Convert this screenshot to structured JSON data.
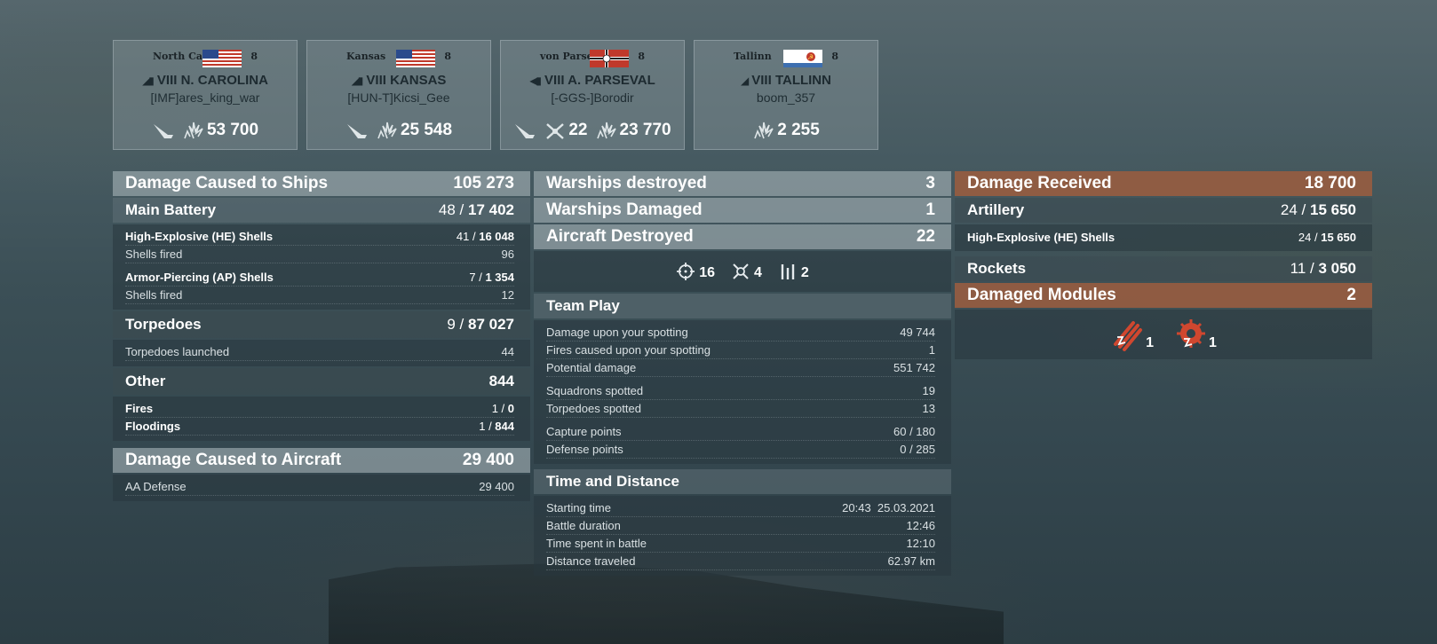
{
  "ships": [
    {
      "name": "North Carolina",
      "tier": "8",
      "flag": "usa",
      "tier_roman": "VIII",
      "title": "N. CAROLINA",
      "player": "[IMF]ares_king_war",
      "plane_icon": true,
      "cap_value": null,
      "damage": "53 700"
    },
    {
      "name": "Kansas",
      "tier": "8",
      "flag": "usa",
      "tier_roman": "VIII",
      "title": "KANSAS",
      "player": "[HUN-T]Kicsi_Gee",
      "plane_icon": true,
      "cap_value": null,
      "damage": "25 548"
    },
    {
      "name": "von Parseval",
      "tier": "8",
      "flag": "germany",
      "tier_roman": "VIII",
      "title": "A. PARSEVAL",
      "player": "[-GGS-]Borodir",
      "plane_icon": true,
      "cap_value": "22",
      "damage": "23 770"
    },
    {
      "name": "Tallinn",
      "tier": "8",
      "flag": "ussr",
      "tier_roman": "VIII",
      "title": "TALLINN",
      "player": "boom_357",
      "plane_icon": false,
      "cap_value": null,
      "damage": "2 255"
    }
  ],
  "damage_ships": {
    "label": "Damage Caused to Ships",
    "value": "105 273",
    "main_battery": {
      "label": "Main Battery",
      "hits": "48",
      "dmg": "17 402"
    },
    "he": {
      "label": "High-Explosive (HE) Shells",
      "hits": "41",
      "dmg": "16 048",
      "fired_label": "Shells fired",
      "fired": "96"
    },
    "ap": {
      "label": "Armor-Piercing (AP) Shells",
      "hits": "7",
      "dmg": "1 354",
      "fired_label": "Shells fired",
      "fired": "12"
    },
    "torpedoes": {
      "label": "Torpedoes",
      "hits": "9",
      "dmg": "87 027",
      "launched_label": "Torpedoes launched",
      "launched": "44"
    },
    "other": {
      "label": "Other",
      "value": "844",
      "fires": {
        "label": "Fires",
        "hits": "1",
        "dmg": "0"
      },
      "floodings": {
        "label": "Floodings",
        "hits": "1",
        "dmg": "844"
      }
    }
  },
  "damage_aircraft": {
    "label": "Damage Caused to Aircraft",
    "value": "29 400",
    "aa_label": "AA Defense",
    "aa": "29 400"
  },
  "warships_destroyed": {
    "label": "Warships destroyed",
    "value": "3"
  },
  "warships_damaged": {
    "label": "Warships Damaged",
    "value": "1"
  },
  "aircraft_destroyed": {
    "label": "Aircraft Destroyed",
    "value": "22",
    "icons": [
      {
        "icon": "crosshair-icon",
        "value": "16"
      },
      {
        "icon": "crossed-fighter-icon",
        "value": "4"
      },
      {
        "icon": "rockets-icon",
        "value": "2"
      }
    ]
  },
  "team_play": {
    "label": "Team Play",
    "rows": [
      {
        "label": "Damage upon your spotting",
        "value": "49 744"
      },
      {
        "label": "Fires caused upon your spotting",
        "value": "1"
      },
      {
        "label": "Potential damage",
        "value": "551 742"
      },
      {
        "label": "Squadrons spotted",
        "value": "19"
      },
      {
        "label": "Torpedoes spotted",
        "value": "13"
      },
      {
        "label": "Capture points",
        "value": "60 / 180"
      },
      {
        "label": "Defense points",
        "value": "0 / 285"
      }
    ]
  },
  "time_distance": {
    "label": "Time and Distance",
    "rows": [
      {
        "label": "Starting time",
        "value": "20:43  25.03.2021"
      },
      {
        "label": "Battle duration",
        "value": "12:46"
      },
      {
        "label": "Time spent in battle",
        "value": "12:10"
      },
      {
        "label": "Distance traveled",
        "value": "62.97 km"
      }
    ]
  },
  "damage_received": {
    "label": "Damage Received",
    "value": "18 700",
    "artillery": {
      "label": "Artillery",
      "hits": "24",
      "dmg": "15 650"
    },
    "he": {
      "label": "High-Explosive (HE) Shells",
      "hits": "24",
      "dmg": "15 650"
    },
    "rockets": {
      "label": "Rockets",
      "hits": "11",
      "dmg": "3 050"
    }
  },
  "damaged_modules": {
    "label": "Damaged Modules",
    "value": "2",
    "icons": [
      {
        "icon": "damaged-torpedo-tubes-icon",
        "value": "1"
      },
      {
        "icon": "damaged-engine-icon",
        "value": "1"
      }
    ]
  },
  "colors": {
    "accent_orange": "#965c41",
    "light_bar": "#a5b2b6"
  }
}
